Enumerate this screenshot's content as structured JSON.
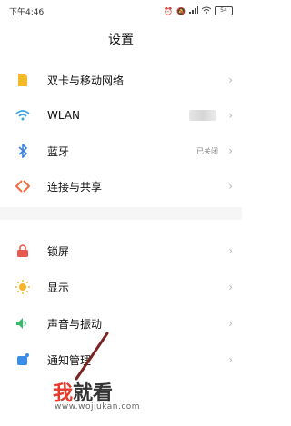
{
  "status_bar": {
    "time": "下午4:46",
    "icons": [
      "alarm-icon",
      "mute-icon",
      "signal-icon",
      "wifi-icon"
    ],
    "battery": "54"
  },
  "page_title": "设置",
  "items": [
    {
      "label": "双卡与移动网络",
      "icon": "sim-card-icon",
      "color": "#f2b928"
    },
    {
      "label": "WLAN",
      "icon": "wifi-icon",
      "color": "#3aa3e3"
    },
    {
      "label": "蓝牙",
      "icon": "bluetooth-icon",
      "color": "#3a82e0",
      "value": "已关闭"
    },
    {
      "label": "连接与共享",
      "icon": "connection-share-icon",
      "color": "#f06b3c"
    },
    {
      "label": "锁屏",
      "icon": "lock-icon",
      "color": "#e85a4f"
    },
    {
      "label": "显示",
      "icon": "display-sun-icon",
      "color": "#f5b42a"
    },
    {
      "label": "声音与振动",
      "icon": "sound-icon",
      "color": "#37b86a"
    },
    {
      "label": "通知管理",
      "icon": "notification-icon",
      "color": "#3a8ee6"
    }
  ],
  "chevron": "›",
  "watermark": {
    "char1": "我",
    "char2": "就看",
    "url": "www.wojiukan.com"
  }
}
